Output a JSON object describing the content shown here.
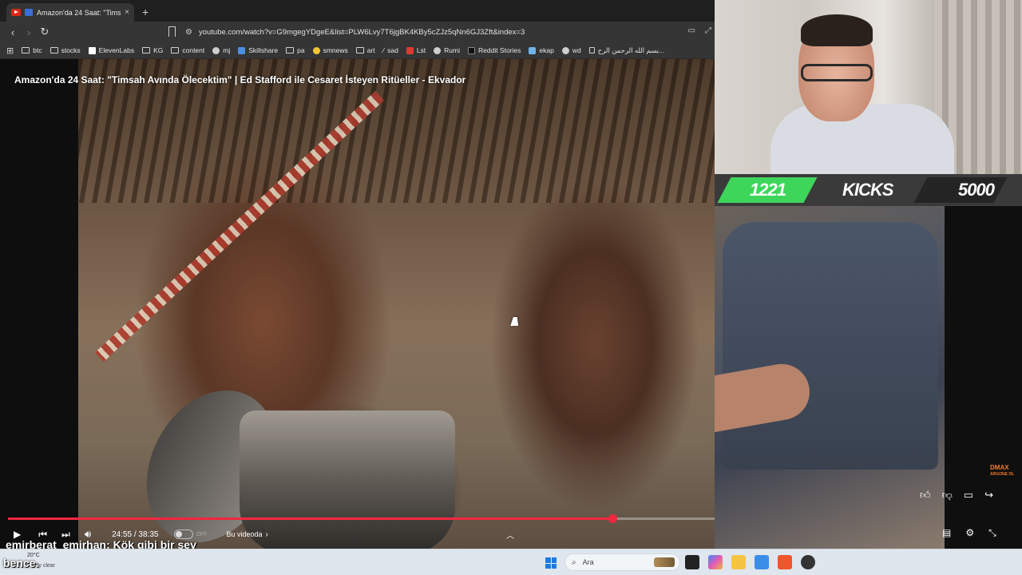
{
  "browser": {
    "tab_title": "Amazon'da 24 Saat: \"Timsah A",
    "tab_close": "×",
    "new_tab": "+",
    "url": "youtube.com/watch?v=G9mgegYDgeE&list=PLW6Lvy7T6jgBK4KBy5cZJz5qNn6GJ3Zft&index=3",
    "bookmarks": [
      "btc",
      "stocks",
      "ElevenLabs",
      "KG",
      "content",
      "mj",
      "Skillshare",
      "pa",
      "smnews",
      "art",
      "sad",
      "Lst",
      "Rumi",
      "Reddit Stories",
      "ekap",
      "wd",
      "بسم الله الرحمن الرح..."
    ]
  },
  "video": {
    "title": "Amazon'da 24 Saat: \"Timsah Avında Ölecektim\" | Ed Stafford ile Cesaret İsteyen Ritüeller - Ekvador",
    "time": "24:55 / 38:35",
    "progress_fraction": 0.6455,
    "cc_state": "OFF",
    "chapter": "Bu videoda",
    "channel_logo": "DMAX",
    "channel_logo_sub": "ARGONE OL"
  },
  "chat": {
    "user": "emirberat_emirhan",
    "message": ": Kök gibi bir şey",
    "line2": "bence."
  },
  "overlay": {
    "count": "1221",
    "label": "KICKS",
    "goal": "5000"
  },
  "taskbar": {
    "temp": "20°C",
    "weather": "Partly clear",
    "search_placeholder": "Ara"
  },
  "colors": {
    "accent_red": "#f1263f",
    "kick_green": "#3dd65b"
  }
}
